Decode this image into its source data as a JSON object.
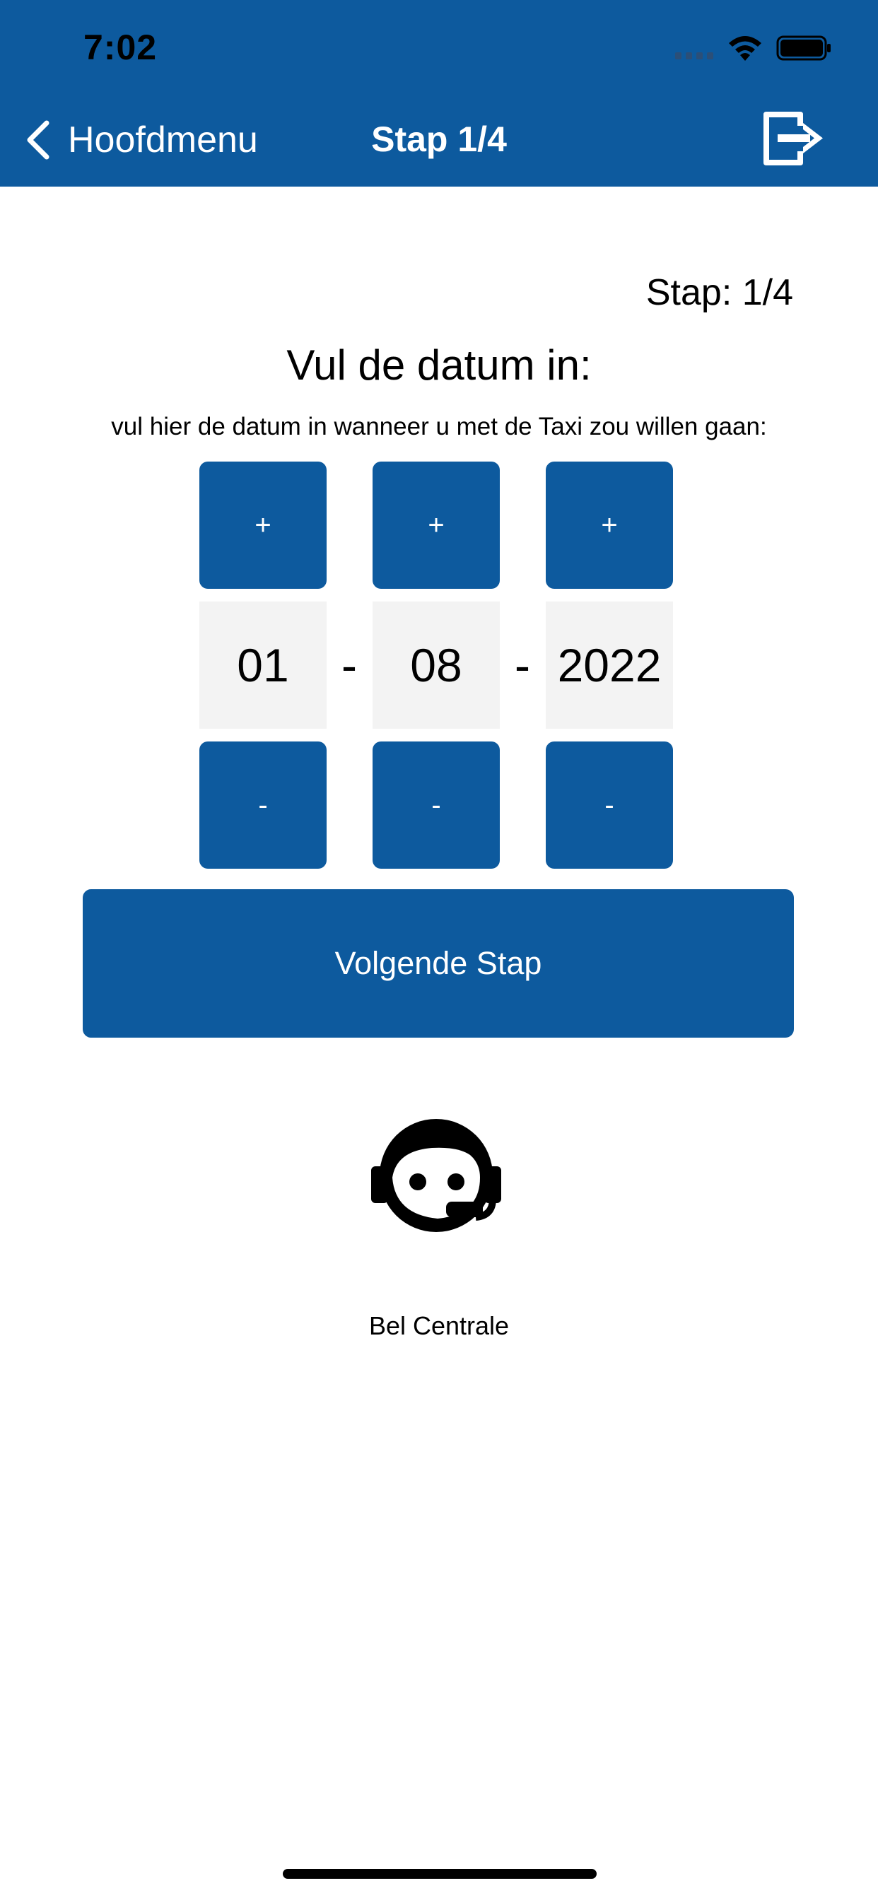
{
  "status_bar": {
    "time": "7:02"
  },
  "nav": {
    "back_label": "Hoofdmenu",
    "title": "Stap 1/4",
    "exit_icon": "exit-icon"
  },
  "content": {
    "step_indicator": "Stap: 1/4",
    "title": "Vul de datum in:",
    "subtitle": "vul hier de datum in wanneer u met de Taxi zou willen gaan:",
    "date": {
      "day": "01",
      "month": "08",
      "year": "2022",
      "separator": "-",
      "increment_label": "+",
      "decrement_label": "-"
    },
    "next_button": "Volgende Stap",
    "support_label": "Bel Centrale"
  },
  "colors": {
    "brand": "#0d5a9e",
    "value_bg": "#f3f3f3"
  }
}
